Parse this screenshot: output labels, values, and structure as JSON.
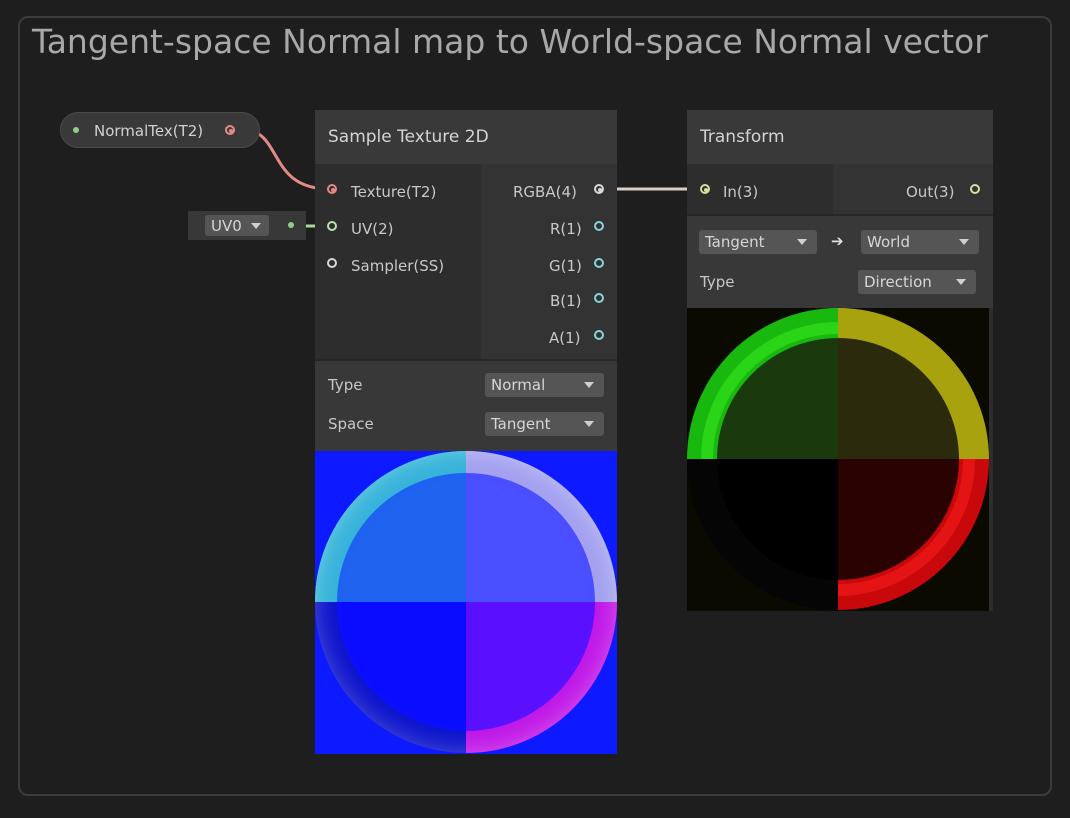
{
  "group": {
    "title": "Tangent-space Normal map to World-space Normal vector"
  },
  "property_node": {
    "label": "NormalTex(T2)"
  },
  "uv_node": {
    "channel": "UV0"
  },
  "sample_node": {
    "title": "Sample Texture 2D",
    "inputs": [
      "Texture(T2)",
      "UV(2)",
      "Sampler(SS)"
    ],
    "outputs": [
      "RGBA(4)",
      "R(1)",
      "G(1)",
      "B(1)",
      "A(1)"
    ],
    "type_label": "Type",
    "type_value": "Normal",
    "space_label": "Space",
    "space_value": "Tangent"
  },
  "transform_node": {
    "title": "Transform",
    "input": "In(3)",
    "output": "Out(3)",
    "from_space": "Tangent",
    "arrow": "➔",
    "to_space": "World",
    "type_label": "Type",
    "type_value": "Direction"
  },
  "colors": {
    "texture_port": "#e48a86",
    "uv_port": "#b8e3ab",
    "vector_port": "#d9dc9b",
    "float_port": "#86d4d6"
  }
}
